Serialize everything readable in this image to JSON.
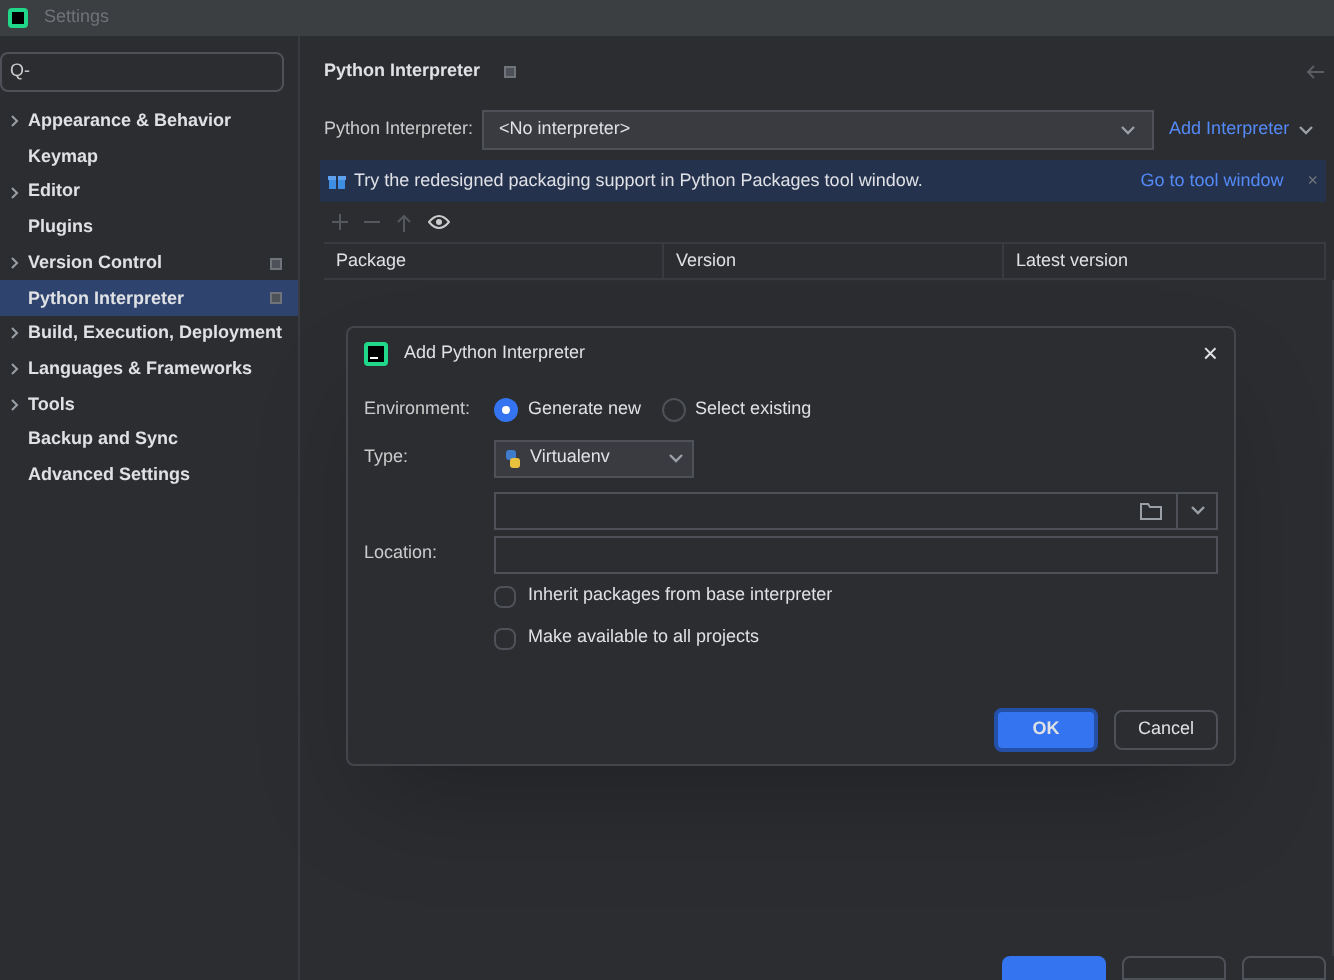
{
  "window": {
    "title": "Settings"
  },
  "sidebar": {
    "search": {
      "value": "Q-"
    },
    "items": [
      {
        "label": "Appearance & Behavior",
        "expandable": true,
        "selected": false,
        "has_marker": false
      },
      {
        "label": "Keymap",
        "expandable": false,
        "selected": false,
        "has_marker": false
      },
      {
        "label": "Editor",
        "expandable": true,
        "selected": false,
        "has_marker": false
      },
      {
        "label": "Plugins",
        "expandable": false,
        "selected": false,
        "has_marker": false
      },
      {
        "label": "Version Control",
        "expandable": true,
        "selected": false,
        "has_marker": true
      },
      {
        "label": "Python Interpreter",
        "expandable": false,
        "selected": true,
        "has_marker": true
      },
      {
        "label": "Build, Execution, Deployment",
        "expandable": true,
        "selected": false,
        "has_marker": false
      },
      {
        "label": "Languages & Frameworks",
        "expandable": true,
        "selected": false,
        "has_marker": false
      },
      {
        "label": "Tools",
        "expandable": true,
        "selected": false,
        "has_marker": false
      },
      {
        "label": "Backup and Sync",
        "expandable": false,
        "selected": false,
        "has_marker": false
      },
      {
        "label": "Advanced Settings",
        "expandable": false,
        "selected": false,
        "has_marker": false
      }
    ]
  },
  "page": {
    "title": "Python Interpreter",
    "interpreter_label": "Python Interpreter:",
    "interpreter_value": "<No interpreter>",
    "add_link": "Add Interpreter",
    "banner": {
      "text": "Try the redesigned packaging support in Python Packages tool window.",
      "link": "Go to tool window",
      "close": "×"
    },
    "columns": [
      "Package",
      "Version",
      "Latest version"
    ]
  },
  "dialog": {
    "title": "Add Python Interpreter",
    "close": "×",
    "environment_label": "Environment:",
    "options": [
      {
        "label": "Generate new",
        "selected": true
      },
      {
        "label": "Select existing",
        "selected": false
      }
    ],
    "type_label": "Type:",
    "type_value": "Virtualenv",
    "location_label": "Location:",
    "checkboxes": [
      {
        "label": "Inherit packages from base interpreter",
        "checked": false
      },
      {
        "label": "Make available to all projects",
        "checked": false
      }
    ],
    "ok": "OK",
    "cancel": "Cancel"
  }
}
